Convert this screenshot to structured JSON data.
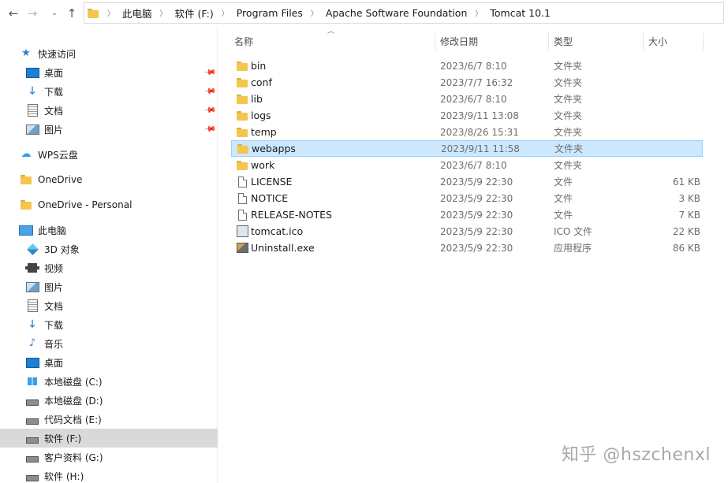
{
  "address": {
    "crumbs": [
      "此电脑",
      "软件 (F:)",
      "Program Files",
      "Apache Software Foundation",
      "Tomcat 10.1"
    ]
  },
  "sidebar": {
    "quick_access": "快速访问",
    "quick_items": [
      "桌面",
      "下载",
      "文档",
      "图片"
    ],
    "wps": "WPS云盘",
    "onedrive": "OneDrive",
    "onedrive_personal": "OneDrive - Personal",
    "this_pc": "此电脑",
    "pc_items": [
      "3D 对象",
      "视频",
      "图片",
      "文档",
      "下载",
      "音乐",
      "桌面"
    ],
    "drives": [
      "本地磁盘 (C:)",
      "本地磁盘 (D:)",
      "代码文档 (E:)",
      "软件 (F:)",
      "客户资料 (G:)",
      "软件 (H:)"
    ]
  },
  "columns": {
    "name": "名称",
    "date": "修改日期",
    "type": "类型",
    "size": "大小"
  },
  "files": [
    {
      "name": "bin",
      "date": "2023/6/7 8:10",
      "type": "文件夹",
      "size": "",
      "icon": "folder-icon"
    },
    {
      "name": "conf",
      "date": "2023/7/7 16:32",
      "type": "文件夹",
      "size": "",
      "icon": "folder-icon"
    },
    {
      "name": "lib",
      "date": "2023/6/7 8:10",
      "type": "文件夹",
      "size": "",
      "icon": "folder-icon"
    },
    {
      "name": "logs",
      "date": "2023/9/11 13:08",
      "type": "文件夹",
      "size": "",
      "icon": "folder-icon"
    },
    {
      "name": "temp",
      "date": "2023/8/26 15:31",
      "type": "文件夹",
      "size": "",
      "icon": "folder-icon"
    },
    {
      "name": "webapps",
      "date": "2023/9/11 11:58",
      "type": "文件夹",
      "size": "",
      "icon": "folder-icon"
    },
    {
      "name": "work",
      "date": "2023/6/7 8:10",
      "type": "文件夹",
      "size": "",
      "icon": "folder-icon"
    },
    {
      "name": "LICENSE",
      "date": "2023/5/9 22:30",
      "type": "文件",
      "size": "61 KB",
      "icon": "file-icon"
    },
    {
      "name": "NOTICE",
      "date": "2023/5/9 22:30",
      "type": "文件",
      "size": "3 KB",
      "icon": "file-icon"
    },
    {
      "name": "RELEASE-NOTES",
      "date": "2023/5/9 22:30",
      "type": "文件",
      "size": "7 KB",
      "icon": "file-icon"
    },
    {
      "name": "tomcat.ico",
      "date": "2023/5/9 22:30",
      "type": "ICO 文件",
      "size": "22 KB",
      "icon": "ico-file-icon"
    },
    {
      "name": "Uninstall.exe",
      "date": "2023/5/9 22:30",
      "type": "应用程序",
      "size": "86 KB",
      "icon": "exe-icon"
    }
  ],
  "watermark": "知乎 @hszchenxl"
}
